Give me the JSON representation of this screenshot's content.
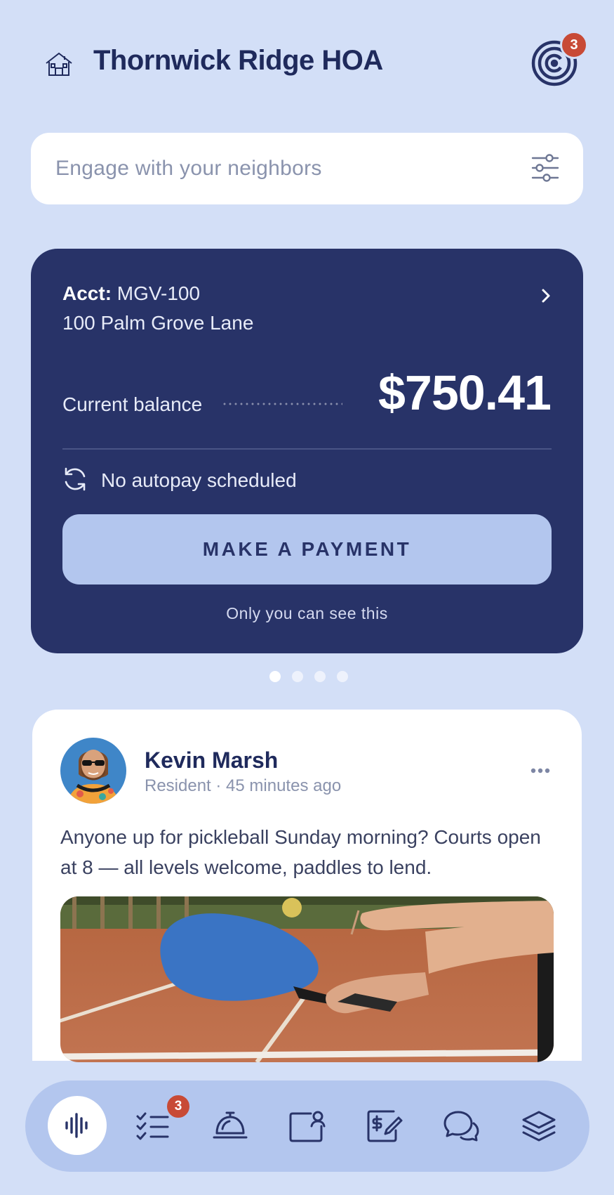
{
  "header": {
    "title": "Thornwick Ridge HOA",
    "notification_count": "3"
  },
  "search": {
    "placeholder": "Engage with your neighbors"
  },
  "account_card": {
    "acct_label": "Acct:",
    "acct_number": "MGV-100",
    "address": "100 Palm Grove Lane",
    "balance_label": "Current balance",
    "balance_amount": "$750.41",
    "autopay_status": "No autopay scheduled",
    "pay_button_label": "MAKE A PAYMENT",
    "privacy_note": "Only you can see this"
  },
  "pager": {
    "total": 4,
    "active_index": 0
  },
  "post": {
    "author": "Kevin Marsh",
    "meta": "Resident · 45 minutes ago",
    "text": "Anyone up for pickleball Sunday morning? Courts open at 8 — all levels welcome, paddles to lend."
  },
  "bottom_nav": {
    "items": [
      {
        "icon": "activity-feed-icon",
        "active": true
      },
      {
        "icon": "tasks-checklist-icon",
        "badge": "3"
      },
      {
        "icon": "concierge-bell-icon"
      },
      {
        "icon": "profile-card-icon"
      },
      {
        "icon": "billing-document-icon"
      },
      {
        "icon": "chat-bubbles-icon"
      },
      {
        "icon": "layers-icon"
      }
    ]
  },
  "colors": {
    "background": "#d3dff7",
    "card_navy": "#283368",
    "button_light": "#b3c6ee",
    "badge_red": "#c84a36",
    "text_dark": "#1f2a5c",
    "text_muted": "#8a93ad"
  }
}
